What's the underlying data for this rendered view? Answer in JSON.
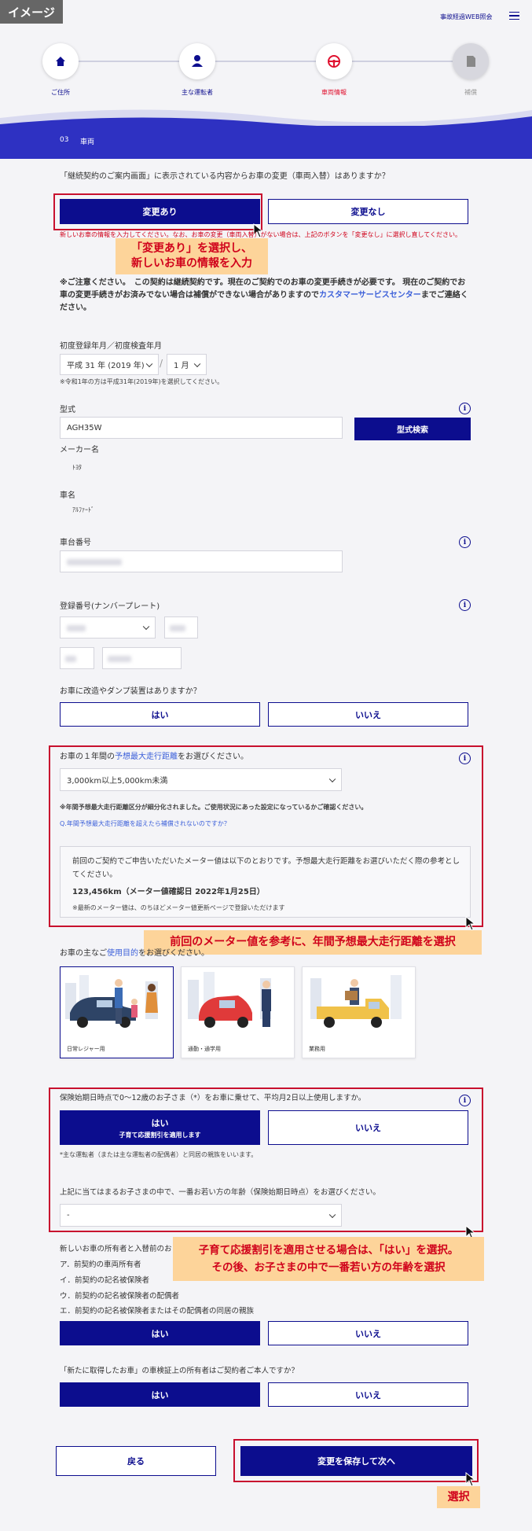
{
  "badge": "イメージ",
  "header": {
    "link": "事故経過WEB照会"
  },
  "steps": [
    {
      "label": "ご住所",
      "icon": "home-icon"
    },
    {
      "label": "主な運転者",
      "icon": "person-icon"
    },
    {
      "label": "車両情報",
      "icon": "steering-wheel-icon"
    },
    {
      "label": "補償",
      "icon": "document-icon"
    }
  ],
  "section": {
    "num": "03",
    "title": "車両"
  },
  "q1": {
    "text": "「継続契約のご案内画面」に表示されている内容からお車の変更（車両入替）はありますか？",
    "yes": "変更あり",
    "no": "変更なし",
    "err": "新しいお車の情報を入力してください。なお、お車の変更（車両入替）がない場合は、上記のボタンを「変更なし」に選択し直してください。"
  },
  "callout1": {
    "l1": "「変更あり」を選択し、",
    "l2": "新しいお車の情報を入力"
  },
  "notice": {
    "pre": "※ご注意ください。　この契約は継続契約です。現在のご契約でのお車の変更手続きが必要です。 現在のご契約でお車の変更手続きがお済みでない場合は補償ができない場合がありますので",
    "link": "カスタマーサービスセンター",
    "post": "までご連絡ください。"
  },
  "reg": {
    "label": "初度登録年月／初度検査年月",
    "year": "平成 31 年 (2019 年)",
    "month": "1 月",
    "note": "※令和1年の方は平成31年(2019年)を選択してください。"
  },
  "model": {
    "label": "型式",
    "value": "AGH35W",
    "button": "型式検索"
  },
  "maker": {
    "label": "メーカー名",
    "value": "ﾄﾖﾀ"
  },
  "car": {
    "label": "車名",
    "value": "ｱﾙﾌｧｰﾄﾞ"
  },
  "chassis": {
    "label": "車台番号"
  },
  "plate": {
    "label": "登録番号(ナンバープレート)"
  },
  "mod": {
    "text": "お車に改造やダンプ装置はありますか？",
    "yes": "はい",
    "no": "いいえ"
  },
  "mileage": {
    "q_pre": "お車の１年間の",
    "q_link": "予想最大走行距離",
    "q_post": "をお選びください。",
    "value": "3,000km以上5,000km未満",
    "note": "※年間予想最大走行距離区分が細分化されました。ご使用状況にあった設定になっているかご確認ください。",
    "faq": "Q.年間予想最大走行距離を超えたら補償されないのですか？",
    "info1": "前回のご契約でご申告いただいたメーター値は以下のとおりです。予想最大走行距離をお選びいただく際の参考としてください。",
    "reading": "123,456km（メーター値確認日 2022年1月25日）",
    "info2": "※最新のメーター値は、のちほどメーター値更新ページで登録いただけます"
  },
  "callout2": "前回のメーター値を参考に、年間予想最大走行距離を選択",
  "usage": {
    "q_pre": "お車の主なご",
    "q_link": "使用目的",
    "q_post": "をお選びください。",
    "opts": [
      "日常レジャー用",
      "通勤・通学用",
      "業務用"
    ]
  },
  "child": {
    "q": "保険始期日時点で0～12歳のお子さま（*）をお車に乗せて、平均月2日以上使用しますか。",
    "yes": "はい",
    "yes_sub": "子育て応援割引を適用します",
    "no": "いいえ",
    "note": "*主な運転者（または主な運転者の配偶者）と同居の親族をいいます。",
    "age_q": "上記に当てはまるお子さまの中で、一番お若い方の年齢（保険始期日時点）をお選びください。",
    "age_val": "-"
  },
  "callout3": {
    "l1": "子育て応援割引を適用させる場合は、「はい」を選択。",
    "l2": "その後、お子さまの中で一番若い方の年齢を選択"
  },
  "owner": {
    "q": "新しいお車の所有者と入替前のお",
    "items": [
      "ア．前契約の車両所有者",
      "イ．前契約の記名被保険者",
      "ウ．前契約の記名被保険者の配偶者",
      "エ．前契約の記名被保険者またはその配偶者の同居の親族"
    ],
    "yes": "はい",
    "no": "いいえ"
  },
  "newcar": {
    "q": "「新たに取得したお車」の車検証上の所有者はご契約者ご本人ですか？",
    "yes": "はい",
    "no": "いいえ"
  },
  "nav": {
    "back": "戻る",
    "next": "変更を保存して次へ"
  },
  "callout4": "選択",
  "colors": {
    "primary": "#0c0d8e",
    "red": "#c8102e",
    "callout": "#fdd49a"
  }
}
